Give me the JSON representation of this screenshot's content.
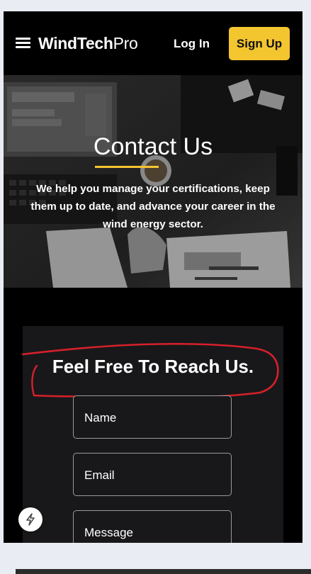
{
  "nav": {
    "logo_bold": "WindTech",
    "logo_light": "Pro",
    "login_label": "Log In",
    "signup_label": "Sign Up"
  },
  "hero": {
    "title": "Contact Us",
    "description": "We help you manage your certifications, keep them up to date, and advance your career in the wind energy sector."
  },
  "contact": {
    "heading": "Feel Free To Reach Us.",
    "fields": {
      "name_placeholder": "Name",
      "email_placeholder": "Email",
      "message_placeholder": "Message"
    }
  },
  "colors": {
    "accent": "#f3c52f",
    "page_background": "#000000",
    "card_background": "#18181a",
    "annotation": "#d6202a"
  },
  "icons": {
    "menu": "hamburger-menu-icon",
    "floating_action": "lightning-bolt-icon"
  }
}
